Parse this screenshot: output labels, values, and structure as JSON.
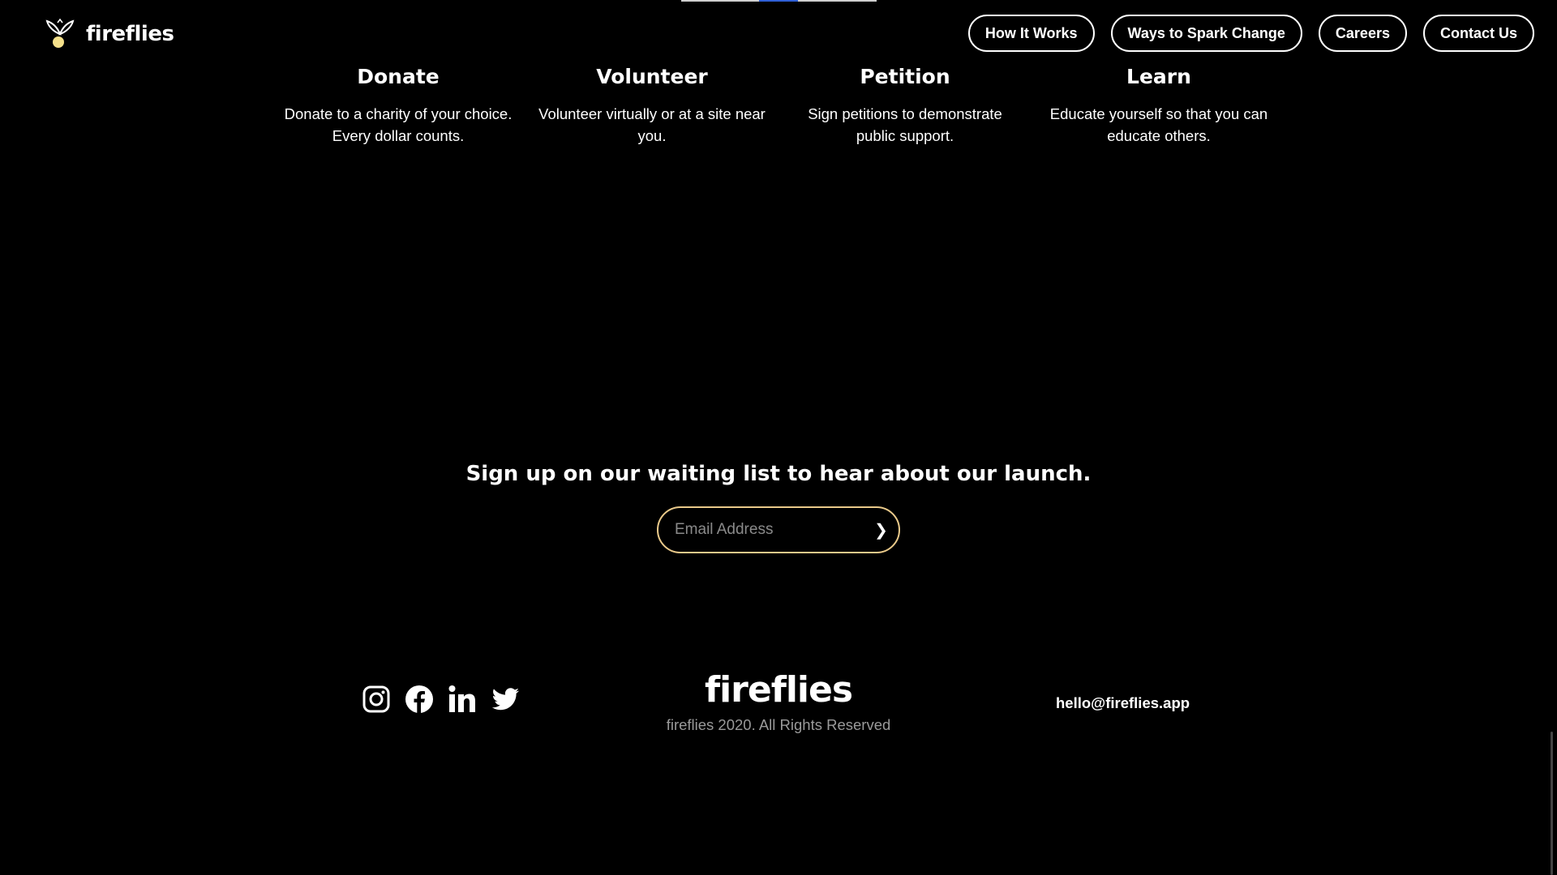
{
  "brand": {
    "name": "fireflies",
    "logo_icon": "firefly-logo-icon",
    "accent_color": "#e9c98a"
  },
  "nav": {
    "items": [
      {
        "label": "How It Works"
      },
      {
        "label": "Ways to Spark Change"
      },
      {
        "label": "Careers"
      },
      {
        "label": "Contact Us"
      }
    ]
  },
  "features": [
    {
      "title": "Donate",
      "line1": "Donate to a charity of your choice.",
      "line2": "Every dollar counts."
    },
    {
      "title": "Volunteer",
      "line1": "Volunteer virtually or at a site near",
      "line2": "you."
    },
    {
      "title": "Petition",
      "line1": "Sign petitions to demonstrate",
      "line2": "public support."
    },
    {
      "title": "Learn",
      "line1": "Educate yourself so that you can",
      "line2": "educate others."
    }
  ],
  "signup": {
    "heading": "Sign up on our waiting list to hear about our launch.",
    "email_placeholder": "Email Address",
    "submit_icon": "chevron-right-icon",
    "submit_glyph": "❯"
  },
  "footer": {
    "brand": "fireflies",
    "copyright": "fireflies 2020. All Rights Reserved",
    "email": "hello@fireflies.app",
    "socials": [
      "instagram-icon",
      "facebook-icon",
      "linkedin-icon",
      "twitter-icon"
    ]
  }
}
